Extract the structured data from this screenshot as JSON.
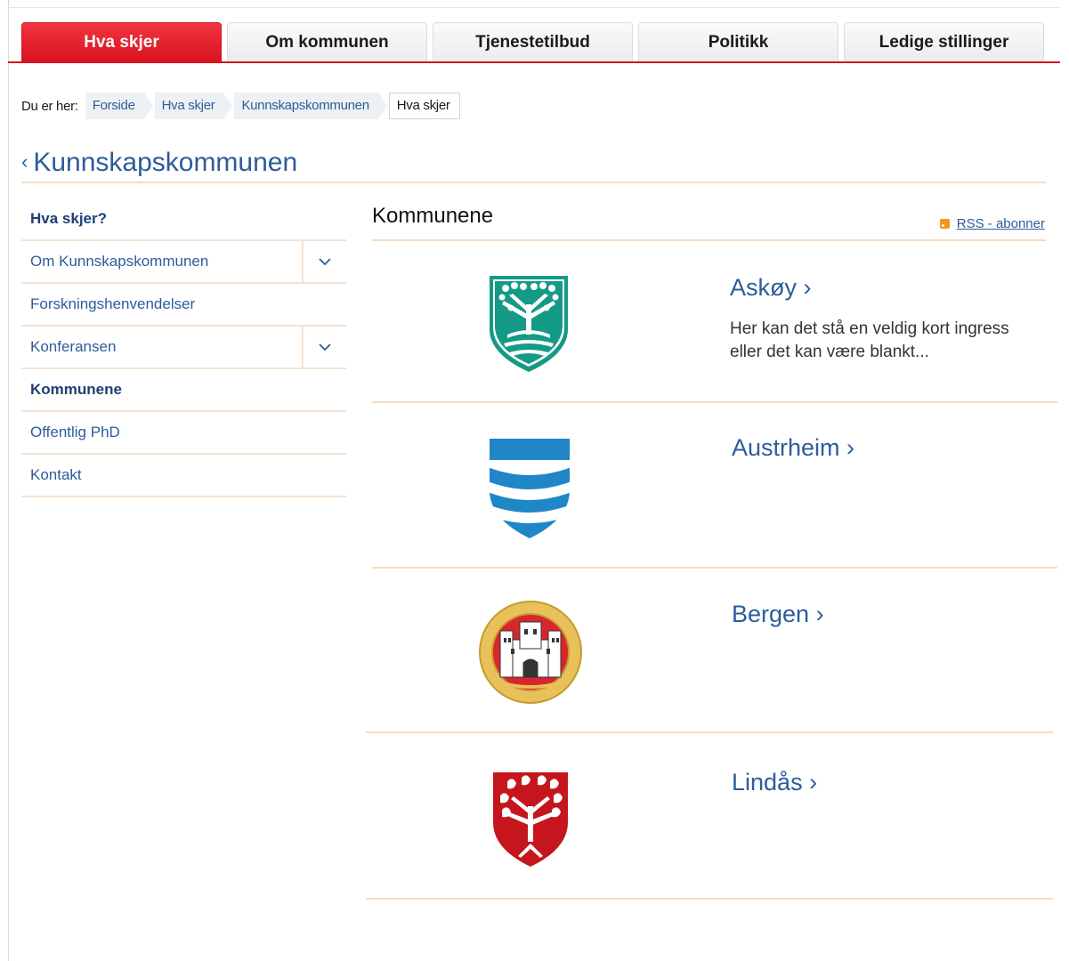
{
  "tabs": [
    {
      "label": "Hva skjer",
      "active": true
    },
    {
      "label": "Om kommunen",
      "active": false
    },
    {
      "label": "Tjenestetilbud",
      "active": false
    },
    {
      "label": "Politikk",
      "active": false
    },
    {
      "label": "Ledige stillinger",
      "active": false
    }
  ],
  "breadcrumb": {
    "label": "Du er her:",
    "items": [
      "Forside",
      "Hva skjer",
      "Kunnskapskommunen",
      "Hva skjer"
    ]
  },
  "section": {
    "back_icon": "chevron-left-icon",
    "title": "Kunnskapskommunen"
  },
  "sidenav": [
    {
      "label": "Hva skjer?",
      "bold": true,
      "expandable": false
    },
    {
      "label": "Om Kunnskapskommunen",
      "bold": false,
      "expandable": true
    },
    {
      "label": "Forskningshenvendelser",
      "bold": false,
      "expandable": false
    },
    {
      "label": "Konferansen",
      "bold": false,
      "expandable": true
    },
    {
      "label": "Kommunene",
      "bold": true,
      "expandable": false
    },
    {
      "label": "Offentlig PhD",
      "bold": false,
      "expandable": false
    },
    {
      "label": "Kontakt",
      "bold": false,
      "expandable": false
    }
  ],
  "main": {
    "title": "Kommunene",
    "rss_label": "RSS - abonner",
    "municipalities": [
      {
        "name": "Askøy ›",
        "ingress": "Her kan det stå en veldig kort ingress eller det kan være blankt...",
        "logo": "askoy-coat-of-arms-icon"
      },
      {
        "name": "Austrheim ›",
        "ingress": "",
        "logo": "austrheim-coat-of-arms-icon"
      },
      {
        "name": "Bergen ›",
        "ingress": "",
        "logo": "bergen-seal-icon"
      },
      {
        "name": "Lindås ›",
        "ingress": "",
        "logo": "lindas-coat-of-arms-icon"
      }
    ]
  },
  "colors": {
    "accent_red": "#d9141f",
    "link_blue": "#2c5c9a",
    "divider": "#f5dcc0"
  }
}
